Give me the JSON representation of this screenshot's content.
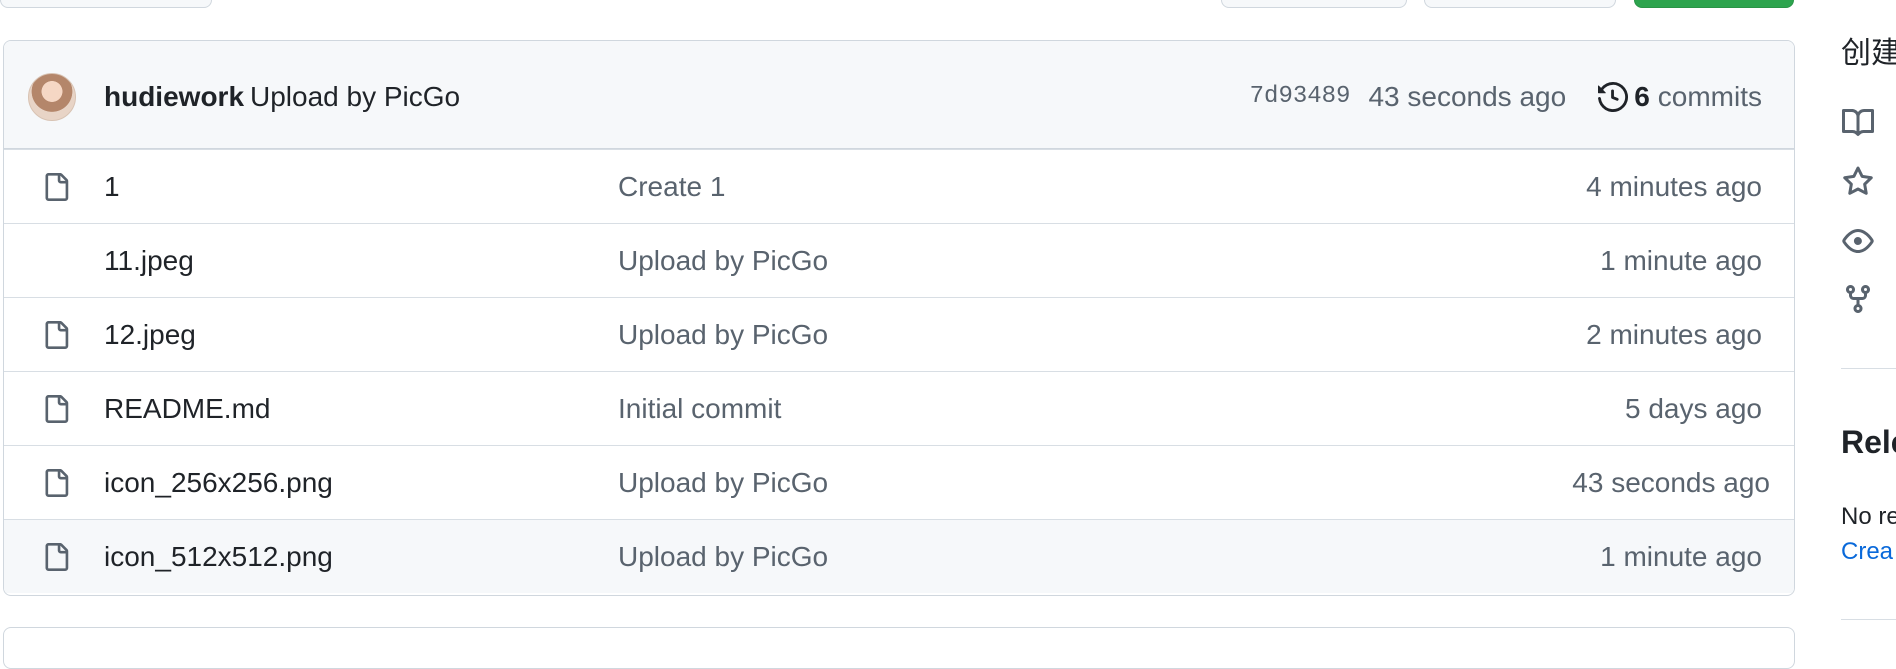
{
  "commit": {
    "author": "hudiework",
    "message": "Upload by PicGo",
    "sha": "7d93489",
    "time": "43 seconds ago",
    "commit_count": "6",
    "commit_label": "commits"
  },
  "files": [
    {
      "name": "1",
      "message": "Create 1",
      "age": "4 minutes ago"
    },
    {
      "name": "11.jpeg",
      "message": "Upload by PicGo",
      "age": "1 minute ago"
    },
    {
      "name": "12.jpeg",
      "message": "Upload by PicGo",
      "age": "2 minutes ago"
    },
    {
      "name": "README.md",
      "message": "Initial commit",
      "age": "5 days ago"
    },
    {
      "name": "icon_256x256.png",
      "message": "Upload by PicGo",
      "age": "43 seconds ago"
    },
    {
      "name": "icon_512x512.png",
      "message": "Upload by PicGo",
      "age": "1 minute ago"
    }
  ],
  "sidebar": {
    "title": "创建",
    "icons": [
      "book-icon",
      "star-icon",
      "eye-icon",
      "fork-icon"
    ],
    "releases_title": "Rele",
    "releases_none": "No re",
    "releases_link": "Crea"
  },
  "colors": {
    "header_bg": "#f6f8fa",
    "border": "#d0d7de",
    "muted_text": "#59636e",
    "link": "#0969da",
    "green_button": "#2da44e"
  }
}
